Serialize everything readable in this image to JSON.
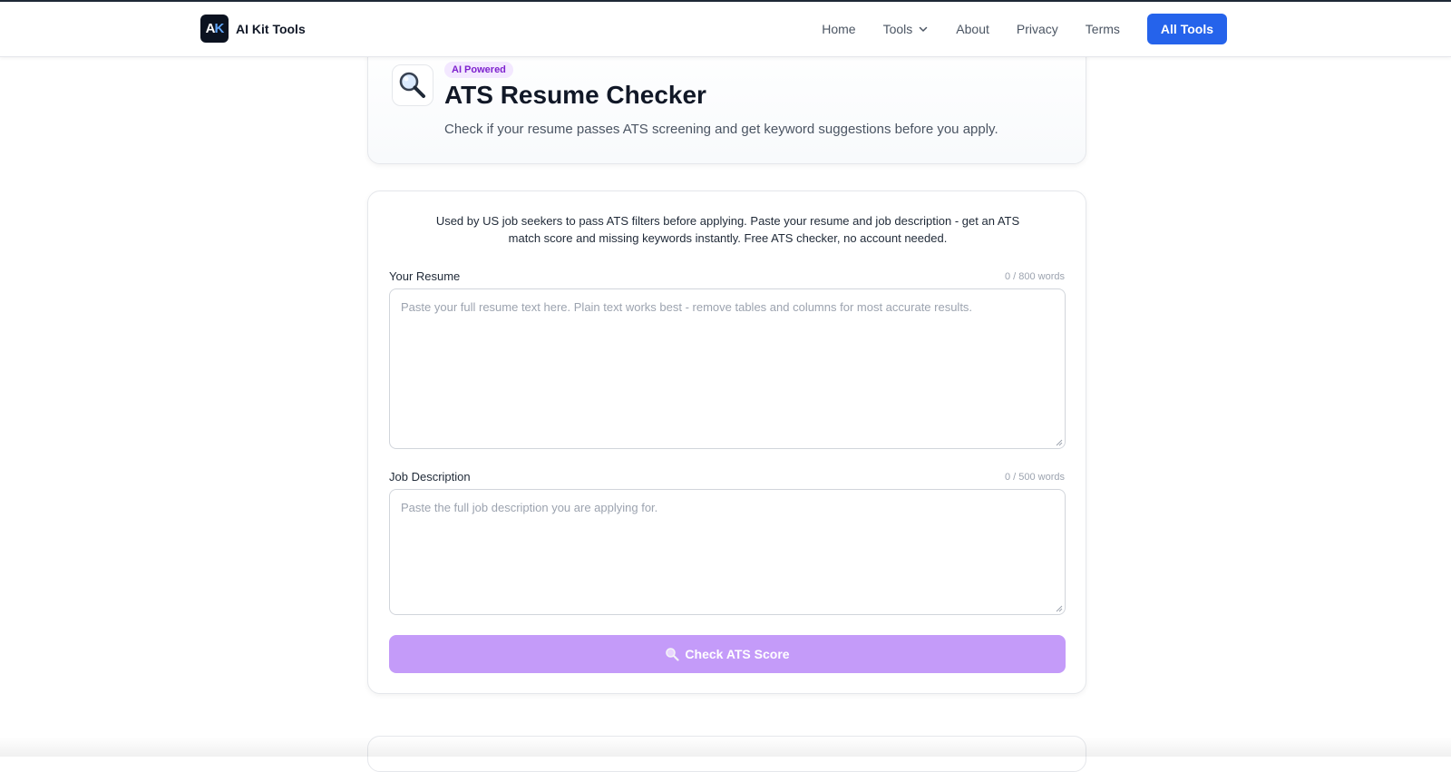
{
  "brand": {
    "logo_text": "AK",
    "name": "AI Kit Tools"
  },
  "nav": {
    "home": "Home",
    "tools": "Tools",
    "about": "About",
    "privacy": "Privacy",
    "terms": "Terms",
    "cta": "All Tools"
  },
  "hero": {
    "icon": "magnifying-glass-icon",
    "badge": "AI Powered",
    "title": "ATS Resume Checker",
    "subtitle": "Check if your resume passes ATS screening and get keyword suggestions before you apply."
  },
  "form": {
    "intro": "Used by US job seekers to pass ATS filters before applying. Paste your resume and job description - get an ATS match score and missing keywords instantly. Free ATS checker, no account needed.",
    "resume": {
      "label": "Your Resume",
      "counter": "0 / 800 words",
      "value": "",
      "placeholder": "Paste your full resume text here. Plain text works best - remove tables and columns for most accurate results."
    },
    "job": {
      "label": "Job Description",
      "counter": "0 / 500 words",
      "value": "",
      "placeholder": "Paste the full job description you are applying for."
    },
    "submit_label": "Check ATS Score"
  },
  "colors": {
    "accent": "#2563eb",
    "badge_bg": "#f3e8ff",
    "badge_text": "#7e22ce",
    "submit_bg": "#c49bf9"
  }
}
